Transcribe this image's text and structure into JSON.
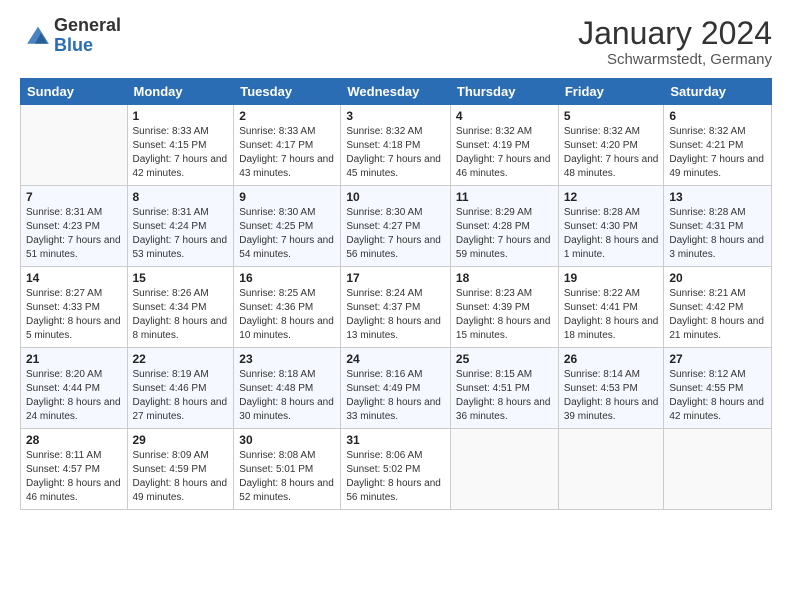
{
  "logo": {
    "general": "General",
    "blue": "Blue"
  },
  "title": "January 2024",
  "subtitle": "Schwarmstedt, Germany",
  "days_of_week": [
    "Sunday",
    "Monday",
    "Tuesday",
    "Wednesday",
    "Thursday",
    "Friday",
    "Saturday"
  ],
  "weeks": [
    [
      {
        "day": "",
        "sunrise": "",
        "sunset": "",
        "daylight": ""
      },
      {
        "day": "1",
        "sunrise": "Sunrise: 8:33 AM",
        "sunset": "Sunset: 4:15 PM",
        "daylight": "Daylight: 7 hours and 42 minutes."
      },
      {
        "day": "2",
        "sunrise": "Sunrise: 8:33 AM",
        "sunset": "Sunset: 4:17 PM",
        "daylight": "Daylight: 7 hours and 43 minutes."
      },
      {
        "day": "3",
        "sunrise": "Sunrise: 8:32 AM",
        "sunset": "Sunset: 4:18 PM",
        "daylight": "Daylight: 7 hours and 45 minutes."
      },
      {
        "day": "4",
        "sunrise": "Sunrise: 8:32 AM",
        "sunset": "Sunset: 4:19 PM",
        "daylight": "Daylight: 7 hours and 46 minutes."
      },
      {
        "day": "5",
        "sunrise": "Sunrise: 8:32 AM",
        "sunset": "Sunset: 4:20 PM",
        "daylight": "Daylight: 7 hours and 48 minutes."
      },
      {
        "day": "6",
        "sunrise": "Sunrise: 8:32 AM",
        "sunset": "Sunset: 4:21 PM",
        "daylight": "Daylight: 7 hours and 49 minutes."
      }
    ],
    [
      {
        "day": "7",
        "sunrise": "Sunrise: 8:31 AM",
        "sunset": "Sunset: 4:23 PM",
        "daylight": "Daylight: 7 hours and 51 minutes."
      },
      {
        "day": "8",
        "sunrise": "Sunrise: 8:31 AM",
        "sunset": "Sunset: 4:24 PM",
        "daylight": "Daylight: 7 hours and 53 minutes."
      },
      {
        "day": "9",
        "sunrise": "Sunrise: 8:30 AM",
        "sunset": "Sunset: 4:25 PM",
        "daylight": "Daylight: 7 hours and 54 minutes."
      },
      {
        "day": "10",
        "sunrise": "Sunrise: 8:30 AM",
        "sunset": "Sunset: 4:27 PM",
        "daylight": "Daylight: 7 hours and 56 minutes."
      },
      {
        "day": "11",
        "sunrise": "Sunrise: 8:29 AM",
        "sunset": "Sunset: 4:28 PM",
        "daylight": "Daylight: 7 hours and 59 minutes."
      },
      {
        "day": "12",
        "sunrise": "Sunrise: 8:28 AM",
        "sunset": "Sunset: 4:30 PM",
        "daylight": "Daylight: 8 hours and 1 minute."
      },
      {
        "day": "13",
        "sunrise": "Sunrise: 8:28 AM",
        "sunset": "Sunset: 4:31 PM",
        "daylight": "Daylight: 8 hours and 3 minutes."
      }
    ],
    [
      {
        "day": "14",
        "sunrise": "Sunrise: 8:27 AM",
        "sunset": "Sunset: 4:33 PM",
        "daylight": "Daylight: 8 hours and 5 minutes."
      },
      {
        "day": "15",
        "sunrise": "Sunrise: 8:26 AM",
        "sunset": "Sunset: 4:34 PM",
        "daylight": "Daylight: 8 hours and 8 minutes."
      },
      {
        "day": "16",
        "sunrise": "Sunrise: 8:25 AM",
        "sunset": "Sunset: 4:36 PM",
        "daylight": "Daylight: 8 hours and 10 minutes."
      },
      {
        "day": "17",
        "sunrise": "Sunrise: 8:24 AM",
        "sunset": "Sunset: 4:37 PM",
        "daylight": "Daylight: 8 hours and 13 minutes."
      },
      {
        "day": "18",
        "sunrise": "Sunrise: 8:23 AM",
        "sunset": "Sunset: 4:39 PM",
        "daylight": "Daylight: 8 hours and 15 minutes."
      },
      {
        "day": "19",
        "sunrise": "Sunrise: 8:22 AM",
        "sunset": "Sunset: 4:41 PM",
        "daylight": "Daylight: 8 hours and 18 minutes."
      },
      {
        "day": "20",
        "sunrise": "Sunrise: 8:21 AM",
        "sunset": "Sunset: 4:42 PM",
        "daylight": "Daylight: 8 hours and 21 minutes."
      }
    ],
    [
      {
        "day": "21",
        "sunrise": "Sunrise: 8:20 AM",
        "sunset": "Sunset: 4:44 PM",
        "daylight": "Daylight: 8 hours and 24 minutes."
      },
      {
        "day": "22",
        "sunrise": "Sunrise: 8:19 AM",
        "sunset": "Sunset: 4:46 PM",
        "daylight": "Daylight: 8 hours and 27 minutes."
      },
      {
        "day": "23",
        "sunrise": "Sunrise: 8:18 AM",
        "sunset": "Sunset: 4:48 PM",
        "daylight": "Daylight: 8 hours and 30 minutes."
      },
      {
        "day": "24",
        "sunrise": "Sunrise: 8:16 AM",
        "sunset": "Sunset: 4:49 PM",
        "daylight": "Daylight: 8 hours and 33 minutes."
      },
      {
        "day": "25",
        "sunrise": "Sunrise: 8:15 AM",
        "sunset": "Sunset: 4:51 PM",
        "daylight": "Daylight: 8 hours and 36 minutes."
      },
      {
        "day": "26",
        "sunrise": "Sunrise: 8:14 AM",
        "sunset": "Sunset: 4:53 PM",
        "daylight": "Daylight: 8 hours and 39 minutes."
      },
      {
        "day": "27",
        "sunrise": "Sunrise: 8:12 AM",
        "sunset": "Sunset: 4:55 PM",
        "daylight": "Daylight: 8 hours and 42 minutes."
      }
    ],
    [
      {
        "day": "28",
        "sunrise": "Sunrise: 8:11 AM",
        "sunset": "Sunset: 4:57 PM",
        "daylight": "Daylight: 8 hours and 46 minutes."
      },
      {
        "day": "29",
        "sunrise": "Sunrise: 8:09 AM",
        "sunset": "Sunset: 4:59 PM",
        "daylight": "Daylight: 8 hours and 49 minutes."
      },
      {
        "day": "30",
        "sunrise": "Sunrise: 8:08 AM",
        "sunset": "Sunset: 5:01 PM",
        "daylight": "Daylight: 8 hours and 52 minutes."
      },
      {
        "day": "31",
        "sunrise": "Sunrise: 8:06 AM",
        "sunset": "Sunset: 5:02 PM",
        "daylight": "Daylight: 8 hours and 56 minutes."
      },
      {
        "day": "",
        "sunrise": "",
        "sunset": "",
        "daylight": ""
      },
      {
        "day": "",
        "sunrise": "",
        "sunset": "",
        "daylight": ""
      },
      {
        "day": "",
        "sunrise": "",
        "sunset": "",
        "daylight": ""
      }
    ]
  ]
}
